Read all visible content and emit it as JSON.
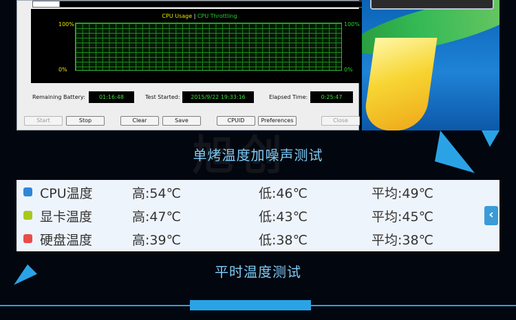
{
  "graph": {
    "legend_cpu": "CPU Usage",
    "legend_sep": "|",
    "legend_throttle": "CPU Throttling",
    "left_top": "100%",
    "left_bottom": "0%",
    "right_top": "100%",
    "right_bottom": "0%",
    "cpu_color": "#e6e600",
    "throttle_color": "#25d525"
  },
  "stats": {
    "battery_label": "Remaining Battery:",
    "battery_value": "01:16:48",
    "started_label": "Test Started:",
    "started_value": "2015/9/22 19:33:16",
    "elapsed_label": "Elapsed Time:",
    "elapsed_value": "0:25:47"
  },
  "buttons": {
    "start": "Start",
    "stop": "Stop",
    "clear": "Clear",
    "save": "Save",
    "cpuid": "CPUID",
    "preferences": "Preferences",
    "close": "Close"
  },
  "captions": {
    "single_bake": "单烤温度加噪声测试",
    "normal": "平时温度测试",
    "watermark": "旭创"
  },
  "temps": [
    {
      "name": "CPU温度",
      "high": "高:54℃",
      "low": "低:46℃",
      "avg": "平均:49℃",
      "color": "#2f86d9"
    },
    {
      "name": "显卡温度",
      "high": "高:47℃",
      "low": "低:43℃",
      "avg": "平均:45℃",
      "color": "#a8c81d"
    },
    {
      "name": "硬盘温度",
      "high": "高:39℃",
      "low": "低:38℃",
      "avg": "平均:38℃",
      "color": "#e84b4b"
    }
  ],
  "scroll_glyph": "‹",
  "accent": "#2aa3e6"
}
